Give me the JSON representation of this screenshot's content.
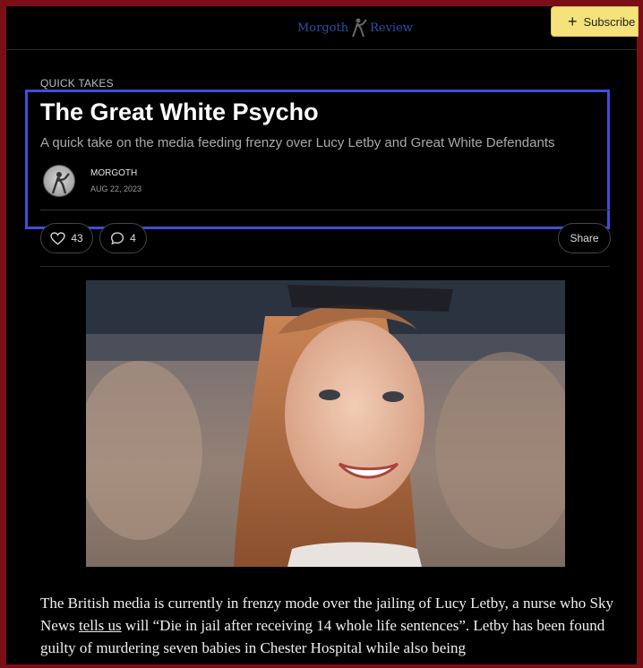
{
  "header": {
    "brand_name_left": "Morgoth",
    "brand_name_right": "Review",
    "subscribe_label": "Subscribe"
  },
  "post": {
    "category": "QUICK TAKES",
    "title": "The Great White Psycho",
    "subtitle": "A quick take on the media feeding frenzy over Lucy Letby and Great White Defendants",
    "author": "MORGOTH",
    "date": "AUG 22, 2023",
    "like_count": "43",
    "comment_count": "4",
    "share_label": "Share"
  },
  "article": {
    "para1_start": "The British media is currently in frenzy mode over the jailing of Lucy Letby, a nurse who Sky News ",
    "para1_link": "tells us",
    "para1_rest": " will “Die in jail after receiving 14 whole life sentences”. Letby has been found guilty of murdering seven babies in Chester Hospital while also being"
  },
  "colors": {
    "frame": "#7a0f17",
    "brand": "#2d4fa3",
    "subscribe_bg": "#f6e27a",
    "highlight": "#3d4fd8"
  },
  "icons": {
    "like": "heart-icon",
    "comment": "speech-bubble-icon",
    "subscribe": "plus-icon"
  }
}
